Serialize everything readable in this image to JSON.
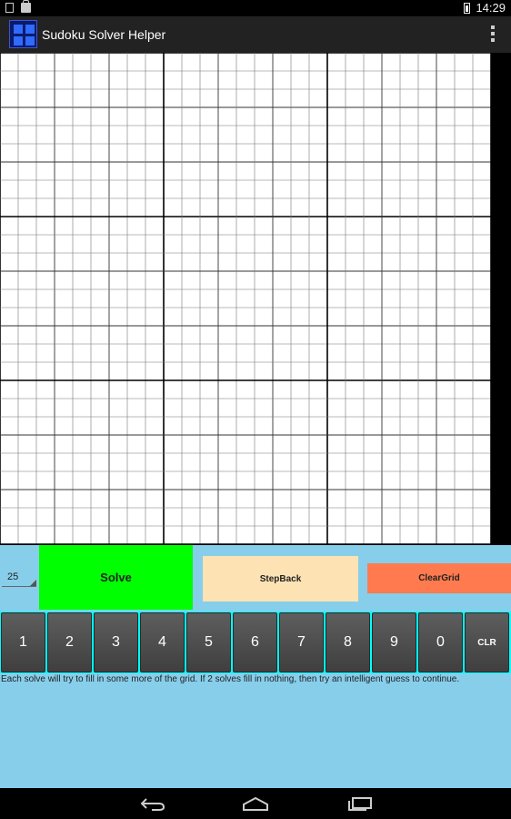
{
  "status_bar": {
    "time": "14:29"
  },
  "action_bar": {
    "title": "Sudoku Solver Helper"
  },
  "grid": {
    "size": 9,
    "subcells": 3,
    "values": []
  },
  "controls": {
    "spinner_value": "25",
    "solve_label": "Solve",
    "stepback_label": "StepBack",
    "cleargrid_label": "ClearGrid"
  },
  "keypad": [
    "1",
    "2",
    "3",
    "4",
    "5",
    "6",
    "7",
    "8",
    "9",
    "0",
    "CLR"
  ],
  "hint": "Each solve will try to fill in some more of the grid. If 2 solves fill in nothing, then try an intelligent guess to continue.",
  "colors": {
    "panel_bg": "#87ceeb",
    "solve_bg": "#00ff00",
    "stepback_bg": "#fde3b3",
    "cleargrid_bg": "#ff7b4f",
    "keypad_border": "#00ffff"
  }
}
